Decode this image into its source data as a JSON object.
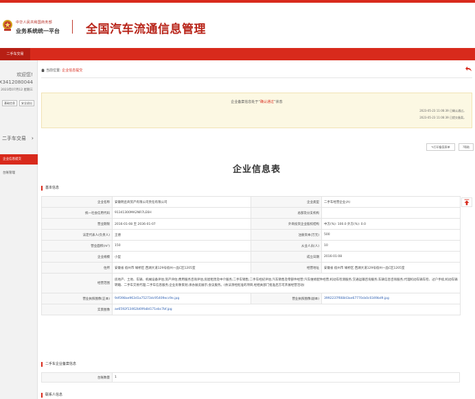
{
  "header": {
    "gov_line1": "中华人民共和国商务部",
    "gov_line2": "业务系统统一平台",
    "system_title": "全国汽车流通信息管理"
  },
  "nav": {
    "active_tab": "二手车交易"
  },
  "sidebar": {
    "welcome": "欢迎您!",
    "user_id": "TX3412080044",
    "login_time": "2023年07月12 星期三",
    "buttons": [
      "基础信息",
      "安全退出"
    ],
    "section": "二手车交易",
    "items": [
      "企业信息提交",
      "台账管理"
    ]
  },
  "breadcrumb": {
    "prefix": "当前位置:",
    "current": "企业信息提交"
  },
  "notice": {
    "main_prefix": "企业备案信息处于“",
    "main_status": "确认通过",
    "main_suffix": "”状态",
    "log1": "2023-05-23 11:06:39 已确认通过。",
    "log2": "2023-05-23 11:06:39 已提交备案。"
  },
  "actions": {
    "print_label": "打印备案表单",
    "help_label": "帮助"
  },
  "form_title": "企业信息表",
  "section_basic": "基本信息",
  "fields": {
    "company_name_label": "企业名称",
    "company_name": "安徽明丞商贸产有限公司责任有限公司",
    "company_type_label": "企业类型",
    "company_type": "二手车经营企业(A)",
    "credit_code_label": "统一社会信用代码",
    "credit_code": "91341300MA2NR7LE6H",
    "branch_label": "总部及分支机构",
    "branch": "",
    "period_label": "营业期限",
    "period": "2016-01-08 至 2036-01-07",
    "capital_ratio_label": "外商投资企业股权结构",
    "capital_ratio": "中方(%): 100.0 外方(%): 0.0",
    "legal_label": "法定代表人(负责人)",
    "legal": "王德",
    "reg_capital_label": "注册资本(万元)",
    "reg_capital": "500",
    "area_label": "营业面积(m²)",
    "area": "150",
    "staff_label": "从业人员(人)",
    "staff": "10",
    "scale_label": "企业规模",
    "scale": "小型",
    "found_label": "成立日期",
    "found": "2016-01-08",
    "address_label": "住所",
    "address": "安徽省 宿州市 埇桥区 西湖大道129号宿州一品C区1205室",
    "biz_address_label": "经营地址",
    "biz_address": "安徽省 宿州市 埇桥区 西湖大道129号宿州一品C区1205室",
    "scope_label": "经营范围",
    "scope": "房地产、土地、车辆、机械设备评估;资产评估;费用服务咨询评估;房屋租赁及中介服务;二手车销售;二手车经纪评估;汽车销售及零部件经营;汽车维修配件经营;机动车检测服务;交通运输咨询服务;车辆信息咨询服务;代理机动车辆车检、过户手续;机动车辆转籍、二手车交易代理;二手车信息服务;企业形象策划;承办展览展示;会议服务。(依法须经批准的项目,经相关部门批准后方可开展经营活动)",
    "license_front_label": "营业执照图像(正本)",
    "license_front": "9df398ae963d1a75273dc95409ecc9e.jpg",
    "license_back_label": "营业执照图像(副本)",
    "license_back": "3992237f668d3ae67770cb0c0349bd9.jpg",
    "photo_label": "实景图像",
    "photo": "ae6592f13462b69fa8d171ebc7bf.jpg"
  },
  "section_used": "二手车企业备案信息",
  "used_fields": {
    "count_label": "台账数量",
    "count": "1"
  },
  "section_contact": "联系人信息"
}
